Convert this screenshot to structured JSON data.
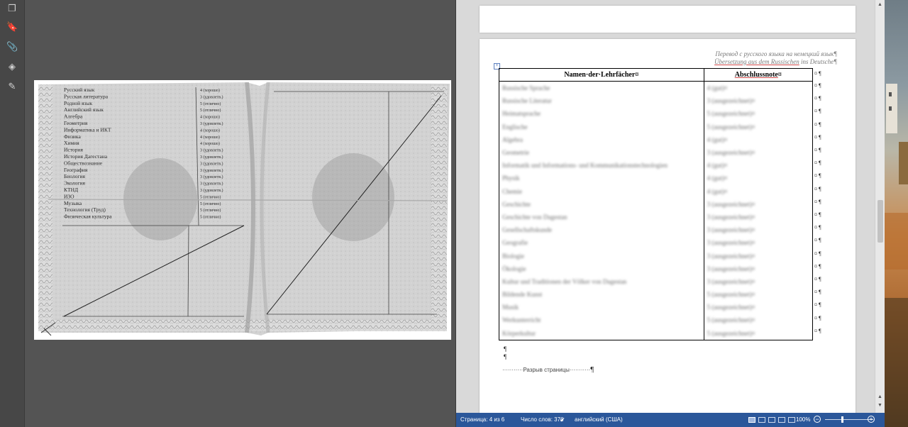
{
  "pdf_viewer": {
    "tools": [
      {
        "icon": "pages-icon",
        "glyph": "❐"
      },
      {
        "icon": "bookmark-icon",
        "glyph": "🔖"
      },
      {
        "icon": "paperclip-icon",
        "glyph": "📎"
      },
      {
        "icon": "layers-icon",
        "glyph": "◈"
      },
      {
        "icon": "signature-icon",
        "glyph": "✎"
      }
    ],
    "scan_rows": [
      "Русский язык",
      "Русская литература",
      "Родной язык",
      "Английский язык",
      "Алгебра",
      "Геометрия",
      "Информатика и ИКТ",
      "Физика",
      "Химия",
      "История",
      "История Дагестана",
      "Обществознание",
      "География",
      "Биология",
      "Экология",
      "КТНД",
      "ИЗО",
      "Музыка",
      "Технология (Труд)",
      "Физическая культура"
    ],
    "scan_grades": [
      "4 (хорошо)",
      "3 (удовлетв.)",
      "5 (отлично)",
      "5 (отлично)",
      "4 (хорошо)",
      "3 (удовлетв.)",
      "4 (хорошо)",
      "4 (хорошо)",
      "4 (хорошо)",
      "3 (удовлетв.)",
      "3 (удовлетв.)",
      "3 (удовлетв.)",
      "3 (удовлетв.)",
      "3 (удовлетв.)",
      "3 (удовлетв.)",
      "3 (удовлетв.)",
      "5 (отлично)",
      "5 (отлично)",
      "5 (отлично)",
      "5 (отлично)"
    ]
  },
  "word": {
    "translation_note": {
      "line1": "Перевод с русского языка на немецкий язык¶",
      "line2_underlined": "Übersetzung aus dem Russischen",
      "line2_rest": " ins Deutsche¶"
    },
    "table": {
      "header_subject": "Namen·der·Lehrfächer¤",
      "header_grade": "Abschlussnote",
      "header_grade_suffix": "¤",
      "rows": [
        {
          "subject": "Russische Sprache",
          "grade": "4 (gut)¤"
        },
        {
          "subject": "Russische Literatur",
          "grade": "3 (ausgezeichnet)¤"
        },
        {
          "subject": "Heimatsprache",
          "grade": "5 (ausgezeichnet)¤"
        },
        {
          "subject": "Englische",
          "grade": "5 (ausgezeichnet)¤"
        },
        {
          "subject": "Algebra",
          "grade": "4 (gut)¤"
        },
        {
          "subject": "Geometrie",
          "grade": "3 (ausgezeichnet)¤"
        },
        {
          "subject": "Informatik und Informations- und Kommunikationstechnologien",
          "grade": "4 (gut)¤"
        },
        {
          "subject": "Physik",
          "grade": "4 (gut)¤"
        },
        {
          "subject": "Chemie",
          "grade": "4 (gut)¤"
        },
        {
          "subject": "Geschichte",
          "grade": "3 (ausgezeichnet)¤"
        },
        {
          "subject": "Geschichte von Dagestan",
          "grade": "3 (ausgezeichnet)¤"
        },
        {
          "subject": "Gesellschaftskunde",
          "grade": "3 (ausgezeichnet)¤"
        },
        {
          "subject": "Geografie",
          "grade": "3 (ausgezeichnet)¤"
        },
        {
          "subject": "Biologie",
          "grade": "3 (ausgezeichnet)¤"
        },
        {
          "subject": "Ökologie",
          "grade": "3 (ausgezeichnet)¤"
        },
        {
          "subject": "Kultur und Traditionen der Völker von Dagestan",
          "grade": "3 (ausgezeichnet)¤"
        },
        {
          "subject": "Bildende Kunst",
          "grade": "5 (ausgezeichnet)¤"
        },
        {
          "subject": "Musik",
          "grade": "5 (ausgezeichnet)¤"
        },
        {
          "subject": "Werkunterricht",
          "grade": "5 (ausgezeichnet)¤"
        },
        {
          "subject": "Körperkultur",
          "grade": "5 (ausgezeichnet)¤"
        }
      ]
    },
    "paragraph_marks": [
      "¶",
      "¶"
    ],
    "page_break": {
      "left_dots": "···········",
      "label": "Разрыв страницы",
      "right_dots": "···········",
      "pilcrow": "¶"
    },
    "status_bar": {
      "page": "Страница: 4 из 6",
      "words": "Число слов: 376",
      "language": "английский (США)",
      "zoom": "100%",
      "zoom_minus": "−",
      "zoom_plus": "+"
    }
  },
  "colors": {
    "status_bar": "#2b579a",
    "pdf_background": "#545454",
    "word_canvas": "#d9d9d9"
  }
}
